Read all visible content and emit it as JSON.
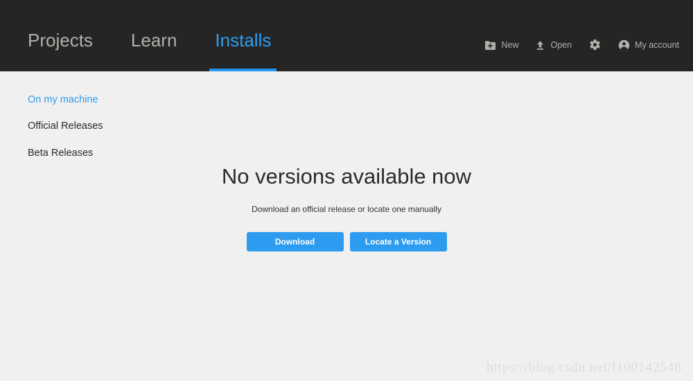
{
  "header": {
    "background": "#252525",
    "accent": "#2196f3",
    "tabs": [
      {
        "label": "Projects",
        "active": false,
        "name": "tab-projects"
      },
      {
        "label": "Learn",
        "active": false,
        "name": "tab-learn"
      },
      {
        "label": "Installs",
        "active": true,
        "name": "tab-installs"
      }
    ],
    "toolbar": [
      {
        "label": "New",
        "icon": "folder-plus-icon"
      },
      {
        "label": "Open",
        "icon": "upload-arrow-icon"
      },
      {
        "label": "",
        "icon": "gear-icon"
      },
      {
        "label": "My account",
        "icon": "account-circle-icon"
      }
    ]
  },
  "sidebar": {
    "items": [
      {
        "label": "On my machine",
        "active": true
      },
      {
        "label": "Official Releases",
        "active": false
      },
      {
        "label": "Beta Releases",
        "active": false
      }
    ]
  },
  "main": {
    "title": "No versions available now",
    "subtitle": "Download an official release or locate one manually",
    "buttons": {
      "download": "Download",
      "locate": "Locate a Version"
    },
    "accent_color": "#2d9cf0"
  },
  "watermark": {
    "text": "https://blog.csdn.net/l100142548"
  }
}
